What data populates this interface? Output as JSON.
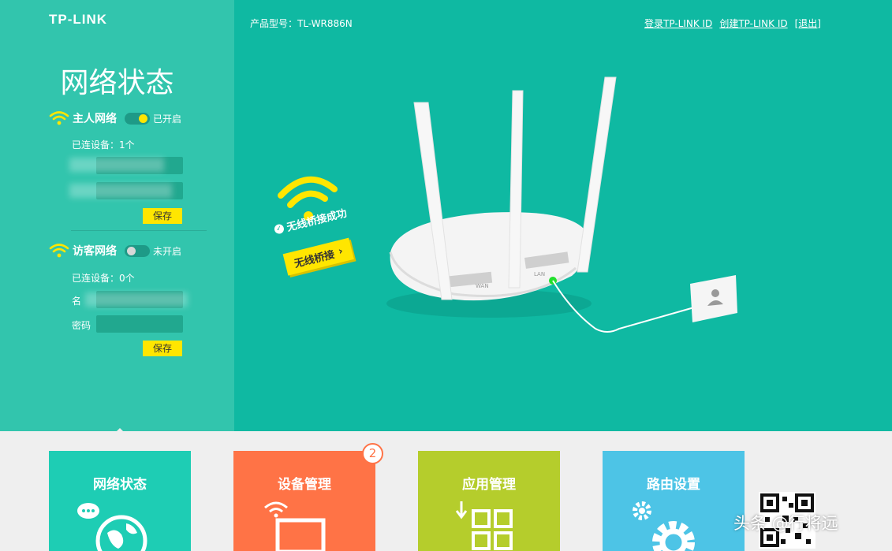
{
  "header": {
    "brand": "TP-LINK",
    "model": "产品型号：TL-WR886N",
    "links": [
      "登录TP-LINK ID",
      "创建TP-LINK ID",
      "[退出]"
    ]
  },
  "sidebar": {
    "title": "网络状态",
    "host_network": {
      "name": "主人网络",
      "state": "已开启",
      "devices": "已连设备：1个",
      "save_label": "保存"
    },
    "guest_network": {
      "name": "访客网络",
      "state": "未开启",
      "devices": "已连设备：0个",
      "name_label": "名",
      "password_label": "密码",
      "save_label": "保存"
    }
  },
  "main": {
    "bridge_status": "无线桥接成功",
    "bridge_button": "无线桥接",
    "router_port_wan": "WAN",
    "router_port_lan": "LAN"
  },
  "tiles": [
    {
      "label": "网络状态",
      "color": "#1ecdb4"
    },
    {
      "label": "设备管理",
      "color": "#ff7346",
      "badge": "2"
    },
    {
      "label": "应用管理",
      "color": "#b5cd2c"
    },
    {
      "label": "路由设置",
      "color": "#4dc4e6"
    }
  ],
  "watermark": "头条 @行将远",
  "colors": {
    "hero_bg": "#0fb9a2",
    "sidebar_bg": "#32c5ad",
    "accent_yellow": "#ffe600"
  }
}
